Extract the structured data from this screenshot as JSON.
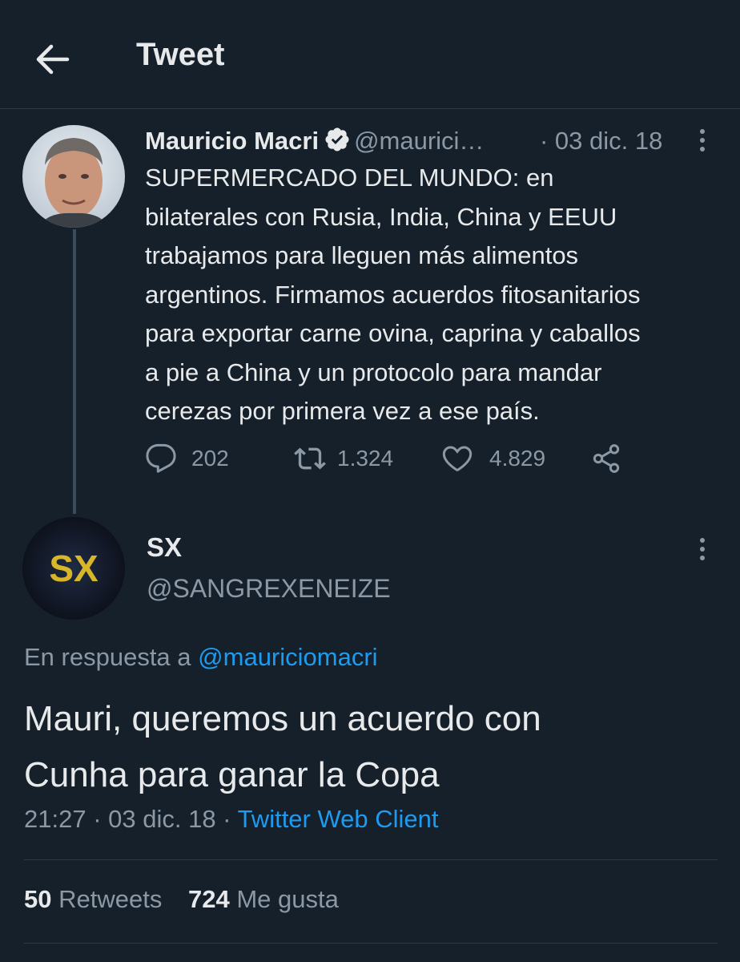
{
  "header": {
    "title": "Tweet",
    "back_icon": "arrow-left-icon"
  },
  "parent_tweet": {
    "author_name": "Mauricio Macri",
    "verified_icon": "verified-badge-icon",
    "handle": "@maurici…",
    "date": "· 03 dic. 18",
    "text_lines": [
      "SUPERMERCADO DEL MUNDO: en",
      "bilaterales con Rusia, India, China y EEUU",
      "trabajamos para lleguen más alimentos",
      "argentinos. Firmamos acuerdos fitosanitarios",
      "para exportar carne ovina, caprina y caballos",
      "a pie a China y un protocolo para mandar",
      "cerezas por primera vez a ese país."
    ],
    "replies": "202",
    "retweets": "1.324",
    "likes": "4.829"
  },
  "reply_tweet": {
    "author_name": "SX",
    "avatar_text": "SX",
    "handle": "@SANGREXENEIZE",
    "in_reply_prefix": "En respuesta a",
    "in_reply_handle": "@mauriciomacri",
    "text_lines": [
      "Mauri, queremos un acuerdo con",
      "Cunha para ganar la Copa"
    ],
    "time": "21:27",
    "date": "· 03 dic. 18 ·",
    "client": "Twitter Web Client",
    "retweet_count": "50",
    "retweet_label": "Retweets",
    "like_count": "724",
    "like_label": "Me gusta"
  },
  "colors": {
    "background": "#15202b",
    "accent": "#1d9bf0",
    "muted": "#8b98a5",
    "avatar_sx_text": "#d8b629"
  }
}
